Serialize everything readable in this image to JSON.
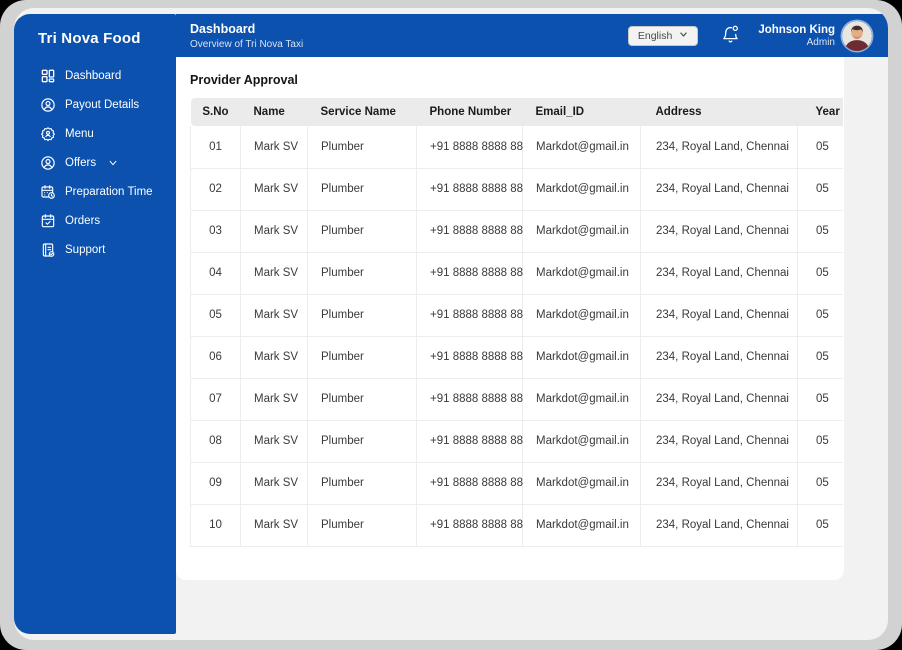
{
  "app": {
    "name": "Tri Nova Food"
  },
  "sidebar": {
    "items": [
      {
        "label": "Dashboard",
        "icon": "dashboard-icon",
        "has_submenu": false
      },
      {
        "label": "Payout Details",
        "icon": "payout-details-icon",
        "has_submenu": false
      },
      {
        "label": "Menu",
        "icon": "menu-gear-icon",
        "has_submenu": false
      },
      {
        "label": "Offers",
        "icon": "offers-icon",
        "has_submenu": true
      },
      {
        "label": "Preparation Time",
        "icon": "preparation-time-icon",
        "has_submenu": false
      },
      {
        "label": "Orders",
        "icon": "orders-icon",
        "has_submenu": false
      },
      {
        "label": "Support",
        "icon": "support-icon",
        "has_submenu": false
      }
    ]
  },
  "header": {
    "title": "Dashboard",
    "subtitle": "Overview of Tri Nova Taxi",
    "language_selector": {
      "value": "English",
      "icon": "chevron-down-icon"
    },
    "notifications": {
      "icon": "bell-icon"
    },
    "user": {
      "name": "Johnson King",
      "role": "Admin"
    }
  },
  "main": {
    "section_title": "Provider Approval",
    "table": {
      "columns": [
        "S.No",
        "Name",
        "Service Name",
        "Phone Number",
        "Email_ID",
        "Address",
        "Year of Experience"
      ],
      "rows": [
        [
          "01",
          "Mark SV",
          "Plumber",
          "+91 8888 8888 88",
          "Markdot@gmail.in",
          "234, Royal Land, Chennai",
          "05"
        ],
        [
          "02",
          "Mark SV",
          "Plumber",
          "+91 8888 8888 88",
          "Markdot@gmail.in",
          "234, Royal Land, Chennai",
          "05"
        ],
        [
          "03",
          "Mark SV",
          "Plumber",
          "+91 8888 8888 88",
          "Markdot@gmail.in",
          "234, Royal Land, Chennai",
          "05"
        ],
        [
          "04",
          "Mark SV",
          "Plumber",
          "+91 8888 8888 88",
          "Markdot@gmail.in",
          "234, Royal Land, Chennai",
          "05"
        ],
        [
          "05",
          "Mark SV",
          "Plumber",
          "+91 8888 8888 88",
          "Markdot@gmail.in",
          "234, Royal Land, Chennai",
          "05"
        ],
        [
          "06",
          "Mark SV",
          "Plumber",
          "+91 8888 8888 88",
          "Markdot@gmail.in",
          "234, Royal Land, Chennai",
          "05"
        ],
        [
          "07",
          "Mark SV",
          "Plumber",
          "+91 8888 8888 88",
          "Markdot@gmail.in",
          "234, Royal Land, Chennai",
          "05"
        ],
        [
          "08",
          "Mark SV",
          "Plumber",
          "+91 8888 8888 88",
          "Markdot@gmail.in",
          "234, Royal Land, Chennai",
          "05"
        ],
        [
          "09",
          "Mark SV",
          "Plumber",
          "+91 8888 8888 88",
          "Markdot@gmail.in",
          "234, Royal Land, Chennai",
          "05"
        ],
        [
          "10",
          "Mark SV",
          "Plumber",
          "+91 8888 8888 88",
          "Markdot@gmail.in",
          "234, Royal Land, Chennai",
          "05"
        ]
      ]
    }
  },
  "colors": {
    "primary": "#0b51ad",
    "content_bg": "#f2f2f2",
    "card_bg": "#ffffff",
    "table_header_bg": "#ebebeb",
    "row_border": "#ededed",
    "frame_rim": "#d2d2d2"
  }
}
